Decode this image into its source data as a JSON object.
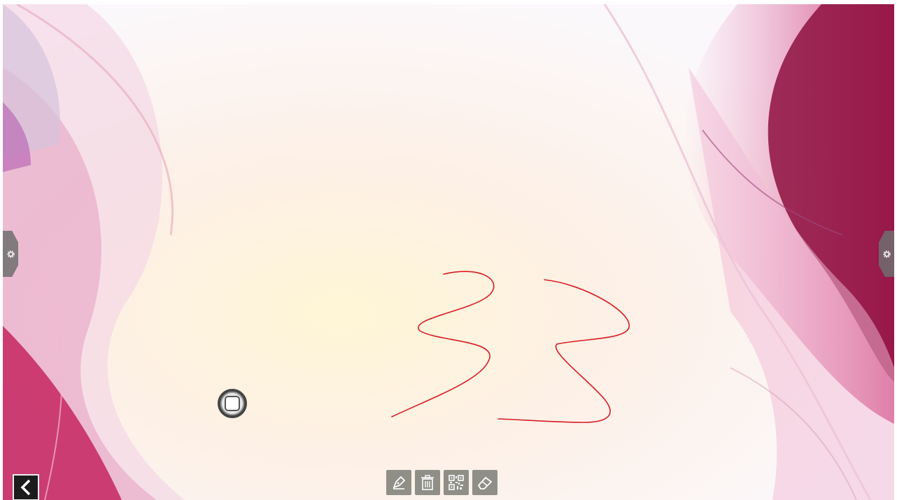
{
  "canvas": {
    "ink_color": "#d81c24",
    "handwriting": "33"
  },
  "side_panels": {
    "left_icon": "gear-icon",
    "right_icon": "gear-icon"
  },
  "floating_button": {
    "icon": "square-icon"
  },
  "back_button": {
    "icon": "chevron-left-icon"
  },
  "toolbar": {
    "tools": [
      {
        "name": "pen",
        "icon": "pen-icon"
      },
      {
        "name": "clear",
        "icon": "trash-icon"
      },
      {
        "name": "qr-code",
        "icon": "qr-code-icon"
      },
      {
        "name": "eraser",
        "icon": "eraser-icon"
      }
    ]
  },
  "colors": {
    "tool_bg": "#8f8f88",
    "back_bg": "#1c1c1c"
  }
}
